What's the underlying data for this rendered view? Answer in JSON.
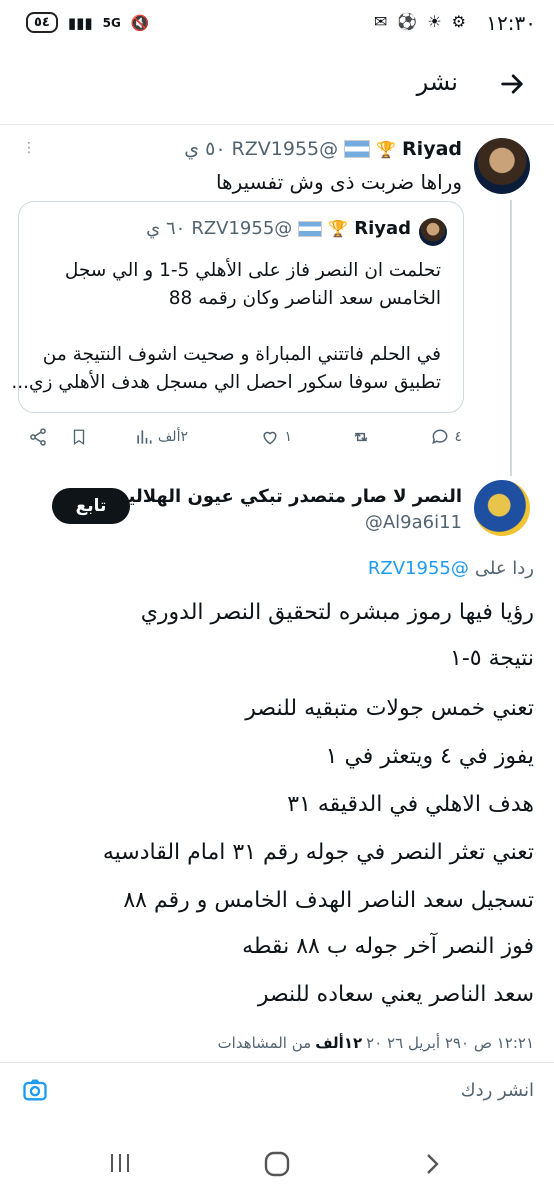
{
  "status_bar": {
    "time": "١٢:٣٠",
    "battery": "٥٤",
    "network": "5G"
  },
  "header": {
    "title": "نشر"
  },
  "tweet1": {
    "name": "Riyad",
    "handle": "@RZV1955",
    "time": "٥٠ ي",
    "text": "وراها ضربت ذى وش تفسيرها"
  },
  "quote": {
    "name": "Riyad",
    "handle": "@RZV1955",
    "time": "٦٠ ي",
    "lines": [
      "تحلمت ان النصر فاز على الأهلي 5-1 و الي سجل",
      "الخامس سعد الناصر وكان رقمه 88",
      "في الحلم فاتتني المباراة و صحيت اشوف النتيجة من",
      "تطبيق سوفا سكور احصل الي مسجل هدف الأهلي زي..."
    ]
  },
  "actions": {
    "replies": "٤",
    "likes": "١",
    "views": "٢ألف"
  },
  "tweet2": {
    "name": "النصر لا صار متصدر تبكي عيون الهلاليه",
    "handle": "@Al9a6i11",
    "follow_label": "تابع",
    "reply_prefix": "ردا على",
    "reply_to": "@RZV1955",
    "lines": [
      "رؤيا فيها رموز مبشره لتحقيق النصر الدوري",
      "نتيجة ٥-١",
      "تعني خمس جولات متبقيه للنصر",
      "يفوز في ٤ ويتعثر في ١",
      "هدف الاهلي في الدقيقه ٣١",
      "تعني تعثر النصر في جوله رقم ٣١ امام القادسيه",
      "تسجيل سعد الناصر الهدف الخامس و رقم ٨٨",
      "فوز النصر آخر جوله ب ٨٨ نقطه",
      "سعد الناصر يعني سعاده للنصر"
    ],
    "meta": "١٢:٢١ ص ٢٩٠ أبريل ٢٦ ٢٠",
    "views_count": "١٢ألف",
    "views_label": "من المشاهدات"
  },
  "reply_box": {
    "placeholder": "انشر ردك"
  },
  "colors": {
    "accent": "#1d9bf0",
    "text": "#0f1419",
    "muted": "#536471"
  }
}
